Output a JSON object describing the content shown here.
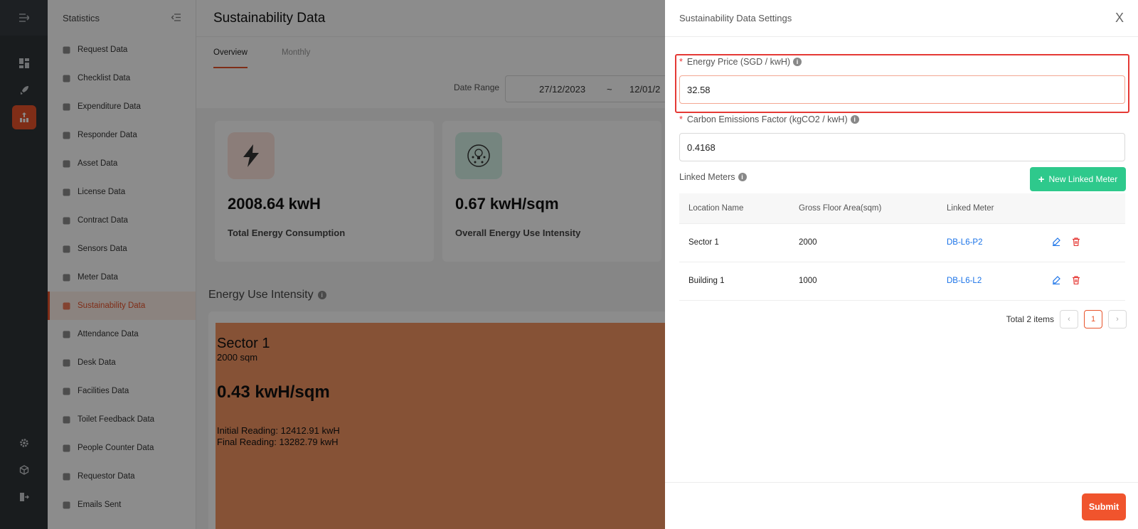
{
  "menu": {
    "header": "Statistics",
    "items": [
      {
        "label": "Request Data",
        "icon": "request-icon"
      },
      {
        "label": "Checklist Data",
        "icon": "checklist-icon"
      },
      {
        "label": "Expenditure Data",
        "icon": "wallet-icon"
      },
      {
        "label": "Responder Data",
        "icon": "responder-icon"
      },
      {
        "label": "Asset Data",
        "icon": "asset-icon"
      },
      {
        "label": "License Data",
        "icon": "shield-icon"
      },
      {
        "label": "Contract Data",
        "icon": "contract-icon"
      },
      {
        "label": "Sensors Data",
        "icon": "sensor-icon"
      },
      {
        "label": "Meter Data",
        "icon": "gauge-icon"
      },
      {
        "label": "Sustainability Data",
        "icon": "leaf-icon"
      },
      {
        "label": "Attendance Data",
        "icon": "calendar-check-icon"
      },
      {
        "label": "Desk Data",
        "icon": "desk-icon"
      },
      {
        "label": "Facilities Data",
        "icon": "facility-icon"
      },
      {
        "label": "Toilet Feedback Data",
        "icon": "list-icon"
      },
      {
        "label": "People Counter Data",
        "icon": "people-counter-icon"
      },
      {
        "label": "Requestor Data",
        "icon": "smile-icon"
      },
      {
        "label": "Emails Sent",
        "icon": "mail-icon"
      }
    ]
  },
  "main": {
    "title": "Sustainability Data",
    "tabs": [
      "Overview",
      "Monthly"
    ],
    "date_range_label": "Date Range",
    "date_from": "27/12/2023",
    "date_sep": "~",
    "date_to": "12/01/2",
    "cards": [
      {
        "value": "2008.64 kwH",
        "caption": "Total Energy Consumption"
      },
      {
        "value": "0.67 kwH/sqm",
        "caption": "Overall Energy Use Intensity"
      }
    ],
    "eui_title": "Energy Use Intensity",
    "tile": {
      "name": "Sector 1",
      "area": "2000 sqm",
      "intensity": "0.43 kwH/sqm",
      "initial": "Initial Reading: 12412.91 kwH",
      "final": "Final Reading: 13282.79 kwH",
      "color": "#f49563"
    }
  },
  "drawer": {
    "title": "Sustainability Data Settings",
    "close": "X",
    "energy_price_label": "Energy Price (SGD / kwH)",
    "energy_price_value": "32.58",
    "carbon_label": "Carbon Emissions Factor (kgCO2 / kwH)",
    "carbon_value": "0.4168",
    "linked_meters_label": "Linked Meters",
    "new_meter_button": "New Linked Meter",
    "table": {
      "headers": [
        "Location Name",
        "Gross Floor Area(sqm)",
        "Linked Meter"
      ],
      "rows": [
        {
          "location": "Sector 1",
          "area": "2000",
          "meter": "DB-L6-P2"
        },
        {
          "location": "Building 1",
          "area": "1000",
          "meter": "DB-L6-L2"
        }
      ]
    },
    "total": "Total 2 items",
    "page": "1",
    "submit": "Submit"
  },
  "colors": {
    "accent": "#e8532a",
    "green": "#2ec98c",
    "link": "#1a73e8",
    "highlight": "#e53935"
  }
}
